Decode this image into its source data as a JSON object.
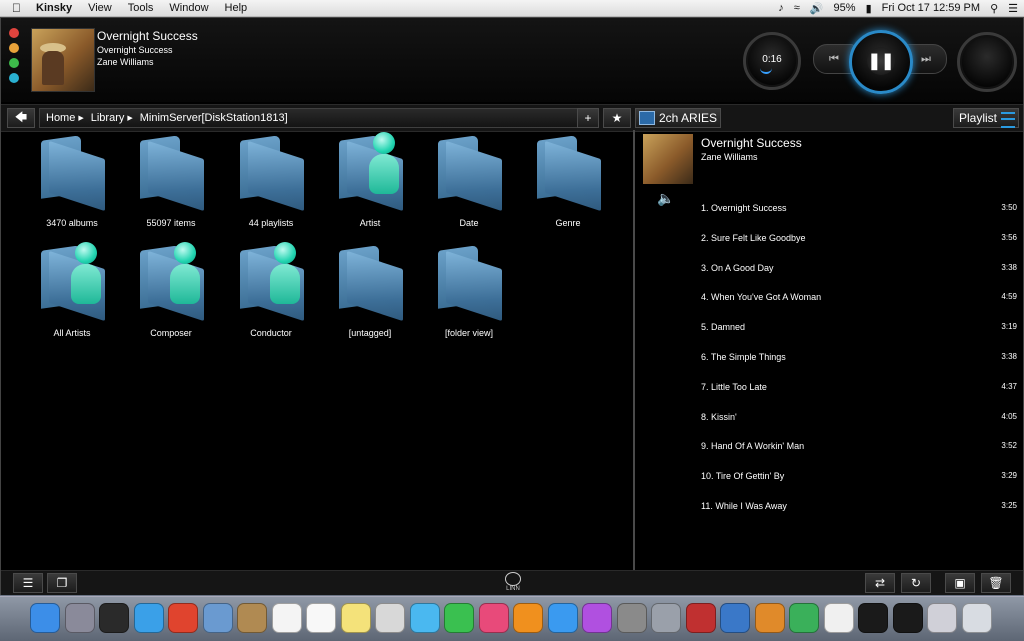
{
  "menubar": {
    "app": "Kinsky",
    "items": [
      "View",
      "Tools",
      "Window",
      "Help"
    ],
    "battery": "95%",
    "clock": "Fri Oct 17  12:59 PM"
  },
  "now_playing": {
    "title": "Overnight Success",
    "album": "Overnight Success",
    "artist": "Zane Williams",
    "elapsed": "0:16"
  },
  "nav": {
    "breadcrumb": [
      "Home",
      "Library",
      "MinimServer[DiskStation1813]"
    ],
    "plus_label": "+",
    "room": "2ch ARIES",
    "playlist_label": "Playlist"
  },
  "folders": [
    {
      "label": "3470 albums",
      "person": false
    },
    {
      "label": "55097 items",
      "person": false
    },
    {
      "label": "44 playlists",
      "person": false
    },
    {
      "label": "Artist",
      "person": true
    },
    {
      "label": "Date",
      "person": false
    },
    {
      "label": "Genre",
      "person": false
    },
    {
      "label": "All Artists",
      "person": true
    },
    {
      "label": "Composer",
      "person": true
    },
    {
      "label": "Conductor",
      "person": true
    },
    {
      "label": "[untagged]",
      "person": false
    },
    {
      "label": "[folder view]",
      "person": false
    }
  ],
  "playlist": {
    "title": "Overnight Success",
    "artist": "Zane Williams",
    "tracks": [
      {
        "name": "1. Overnight Success",
        "duration": "3:50"
      },
      {
        "name": "2. Sure Felt Like Goodbye",
        "duration": "3:56"
      },
      {
        "name": "3. On A Good Day",
        "duration": "3:38"
      },
      {
        "name": "4. When You've Got A Woman",
        "duration": "4:59"
      },
      {
        "name": "5. Damned",
        "duration": "3:19"
      },
      {
        "name": "6. The Simple Things",
        "duration": "3:38"
      },
      {
        "name": "7. Little Too Late",
        "duration": "4:37"
      },
      {
        "name": "8. Kissin'",
        "duration": "4:05"
      },
      {
        "name": "9. Hand Of A Workin' Man",
        "duration": "3:52"
      },
      {
        "name": "10. Tire Of Gettin' By",
        "duration": "3:29"
      },
      {
        "name": "11. While I Was Away",
        "duration": "3:25"
      }
    ]
  },
  "footer": {
    "logo": "LINN"
  },
  "colors": {
    "accent": "#2a9ae0",
    "person": "#22d4b0",
    "folder": "#5b8fb8"
  }
}
